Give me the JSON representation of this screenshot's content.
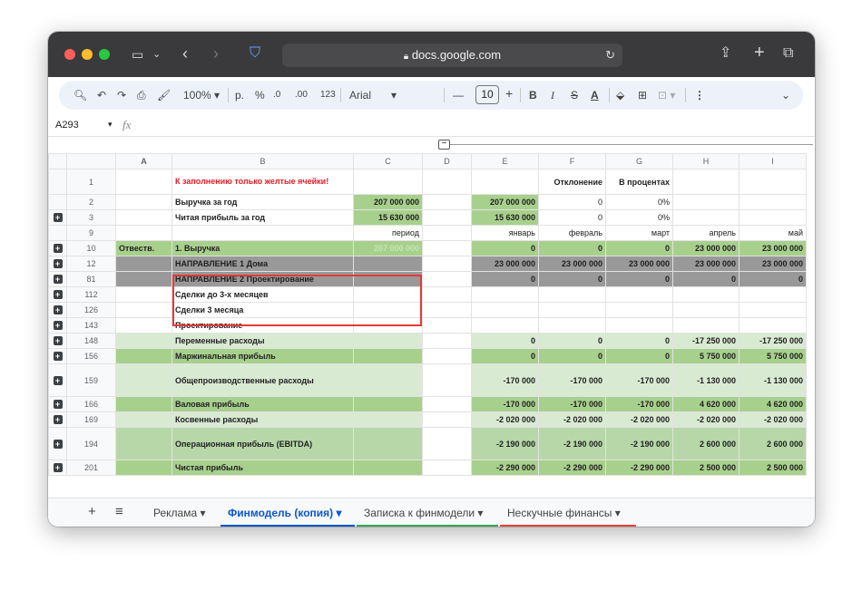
{
  "browser": {
    "url": "docs.google.com",
    "colors": {
      "close": "#ff5f57",
      "min": "#febc2e",
      "max": "#28c840"
    }
  },
  "toolbar": {
    "zoom": "100%",
    "currency": "р.",
    "percent": "%",
    "dec_minus": ".0",
    "dec_plus": ".00",
    "format_123": "123",
    "font": "Arial",
    "font_size": "10",
    "bold": "B",
    "italic": "I",
    "strike": "S",
    "text_color": "A",
    "more": "⋮"
  },
  "formula_bar": {
    "cell_ref": "A293",
    "fx": "fx"
  },
  "columns": [
    "A",
    "B",
    "C",
    "D",
    "E",
    "F",
    "G",
    "H",
    "I"
  ],
  "rows": [
    {
      "num": "1",
      "plus": false,
      "a": "",
      "b": "К заполнению только желтые ячейки!",
      "c": "",
      "d": "",
      "e": "",
      "f": "Отклонение",
      "g": "В процентах",
      "h": "",
      "i": ""
    },
    {
      "num": "2",
      "plus": false,
      "a": "",
      "b": "Выручка за год",
      "c": "207 000 000",
      "d": "",
      "e": "207 000 000",
      "f": "0",
      "g": "0%",
      "h": "",
      "i": ""
    },
    {
      "num": "3",
      "plus": true,
      "a": "",
      "b": "Читая прибыль за год",
      "c": "15 630 000",
      "d": "",
      "e": "15 630 000",
      "f": "0",
      "g": "0%",
      "h": "",
      "i": ""
    },
    {
      "num": "9",
      "plus": false,
      "a": "",
      "b": "",
      "c": "период",
      "d": "",
      "e": "январь",
      "f": "февраль",
      "g": "март",
      "h": "апрель",
      "i": "май"
    },
    {
      "num": "10",
      "plus": true,
      "a": "Отвеств.",
      "b": "1. Выручка",
      "c": "207 000 000",
      "d": "",
      "e": "0",
      "f": "0",
      "g": "0",
      "h": "23 000 000",
      "i": "23 000 000"
    },
    {
      "num": "12",
      "plus": true,
      "a": "",
      "b": "НАПРАВЛЕНИЕ 1 Дома",
      "c": "",
      "d": "",
      "e": "23 000 000",
      "f": "23 000 000",
      "g": "23 000 000",
      "h": "23 000 000",
      "i": "23 000 000"
    },
    {
      "num": "81",
      "plus": true,
      "a": "",
      "b": "НАПРАВЛЕНИЕ 2 Проектирование",
      "c": "",
      "d": "",
      "e": "0",
      "f": "0",
      "g": "0",
      "h": "0",
      "i": "0"
    },
    {
      "num": "112",
      "plus": true,
      "a": "",
      "b": "Сделки до 3-х месяцев",
      "c": "",
      "d": "",
      "e": "",
      "f": "",
      "g": "",
      "h": "",
      "i": ""
    },
    {
      "num": "126",
      "plus": true,
      "a": "",
      "b": "Сделки 3 месяца",
      "c": "",
      "d": "",
      "e": "",
      "f": "",
      "g": "",
      "h": "",
      "i": ""
    },
    {
      "num": "143",
      "plus": true,
      "a": "",
      "b": "Проектирование",
      "c": "",
      "d": "",
      "e": "",
      "f": "",
      "g": "",
      "h": "",
      "i": ""
    },
    {
      "num": "148",
      "plus": true,
      "a": "",
      "b": "Переменные расходы",
      "c": "",
      "d": "",
      "e": "0",
      "f": "0",
      "g": "0",
      "h": "-17 250 000",
      "i": "-17 250 000"
    },
    {
      "num": "156",
      "plus": true,
      "a": "",
      "b": "Маржинальная прибыль",
      "c": "",
      "d": "",
      "e": "0",
      "f": "0",
      "g": "0",
      "h": "5 750 000",
      "i": "5 750 000"
    },
    {
      "num": "159",
      "plus": true,
      "a": "",
      "b": "Общепроизводственные расходы",
      "c": "",
      "d": "",
      "e": "-170 000",
      "f": "-170 000",
      "g": "-170 000",
      "h": "-1 130 000",
      "i": "-1 130 000"
    },
    {
      "num": "166",
      "plus": true,
      "a": "",
      "b": "Валовая прибыль",
      "c": "",
      "d": "",
      "e": "-170 000",
      "f": "-170 000",
      "g": "-170 000",
      "h": "4 620 000",
      "i": "4 620 000"
    },
    {
      "num": "169",
      "plus": true,
      "a": "",
      "b": "Косвенные расходы",
      "c": "",
      "d": "",
      "e": "-2 020 000",
      "f": "-2 020 000",
      "g": "-2 020 000",
      "h": "-2 020 000",
      "i": "-2 020 000"
    },
    {
      "num": "194",
      "plus": true,
      "a": "",
      "b": "Операционная прибыль (EBITDA)",
      "c": "",
      "d": "",
      "e": "-2 190 000",
      "f": "-2 190 000",
      "g": "-2 190 000",
      "h": "2 600 000",
      "i": "2 600 000"
    },
    {
      "num": "201",
      "plus": true,
      "a": "",
      "b": "Чистая прибыль",
      "c": "",
      "d": "",
      "e": "-2 290 000",
      "f": "-2 290 000",
      "g": "-2 290 000",
      "h": "2 500 000",
      "i": "2 500 000"
    }
  ],
  "tabs": {
    "add": "+",
    "menu": "≡",
    "items": [
      {
        "label": "Реклама",
        "active": false
      },
      {
        "label": "Финмодель (копия)",
        "active": true
      },
      {
        "label": "Записка к финмодели",
        "active": false
      },
      {
        "label": "Нескучные финансы",
        "active": false
      }
    ]
  },
  "accent_colors": {
    "active_tab": "#0b57d0",
    "tab3_line": "#34a853",
    "tab4_line": "#ea4335",
    "selection": "#e53935"
  }
}
